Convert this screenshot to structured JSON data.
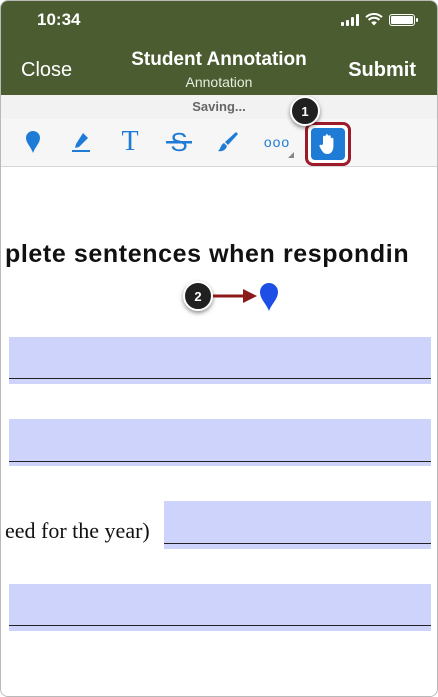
{
  "status_bar": {
    "time": "10:34"
  },
  "nav": {
    "close_label": "Close",
    "title": "Student Annotation",
    "subtitle": "Annotation",
    "submit_label": "Submit"
  },
  "saving_text": "Saving...",
  "toolbar": {
    "tools": [
      "point-annotation",
      "highlight",
      "text",
      "strikeout",
      "freehand",
      "more",
      "pan"
    ],
    "text_glyph": "T",
    "strike_glyph": "S",
    "more_glyph": "ooo",
    "selected_tool": "pan"
  },
  "callouts": {
    "one": "1",
    "two": "2"
  },
  "document": {
    "heading": "plete sentences when respondin",
    "line_text": "eed for the year)"
  },
  "colors": {
    "header": "#4b5c31",
    "accent": "#1f7cd6",
    "highlight_border": "#9b1b2a",
    "form_field": "#cdd3fb",
    "arrow": "#8b1a1a",
    "pin": "#1d4fe6"
  }
}
